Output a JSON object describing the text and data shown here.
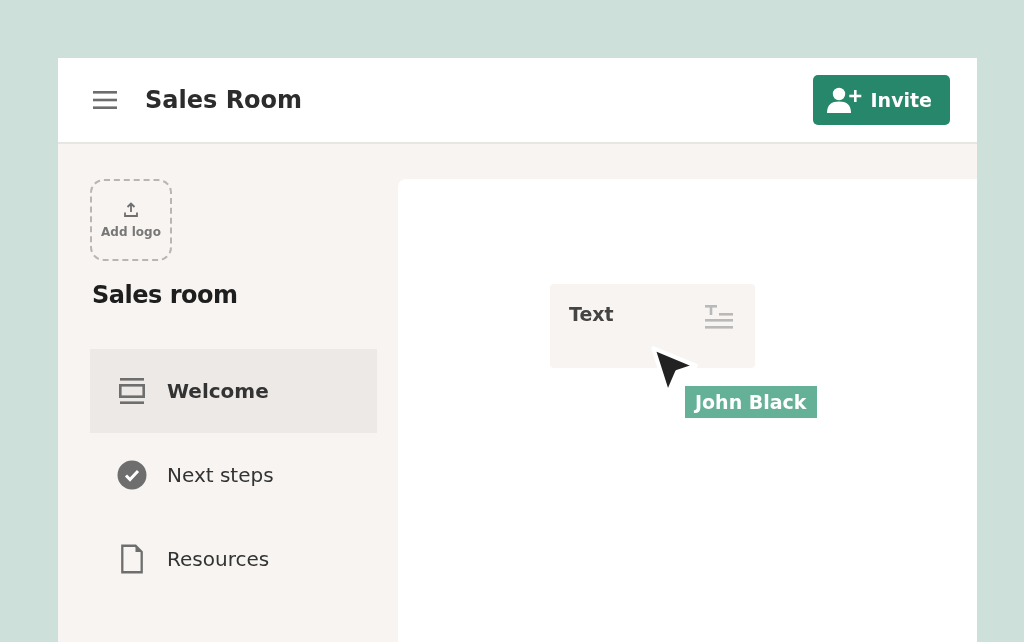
{
  "header": {
    "title": "Sales Room",
    "invite_button": "Invite"
  },
  "sidebar": {
    "logo_upload": "Add logo",
    "room_title": "Sales room",
    "items": [
      {
        "kind": "welcome",
        "label": "Welcome",
        "selected": true
      },
      {
        "kind": "steps",
        "label": "Next steps",
        "selected": false
      },
      {
        "kind": "document",
        "label": "Resources",
        "selected": false
      }
    ]
  },
  "canvas": {
    "text_block": {
      "label": "Text"
    },
    "cursor_user": {
      "name": "John Black",
      "color": "#65b197"
    }
  }
}
